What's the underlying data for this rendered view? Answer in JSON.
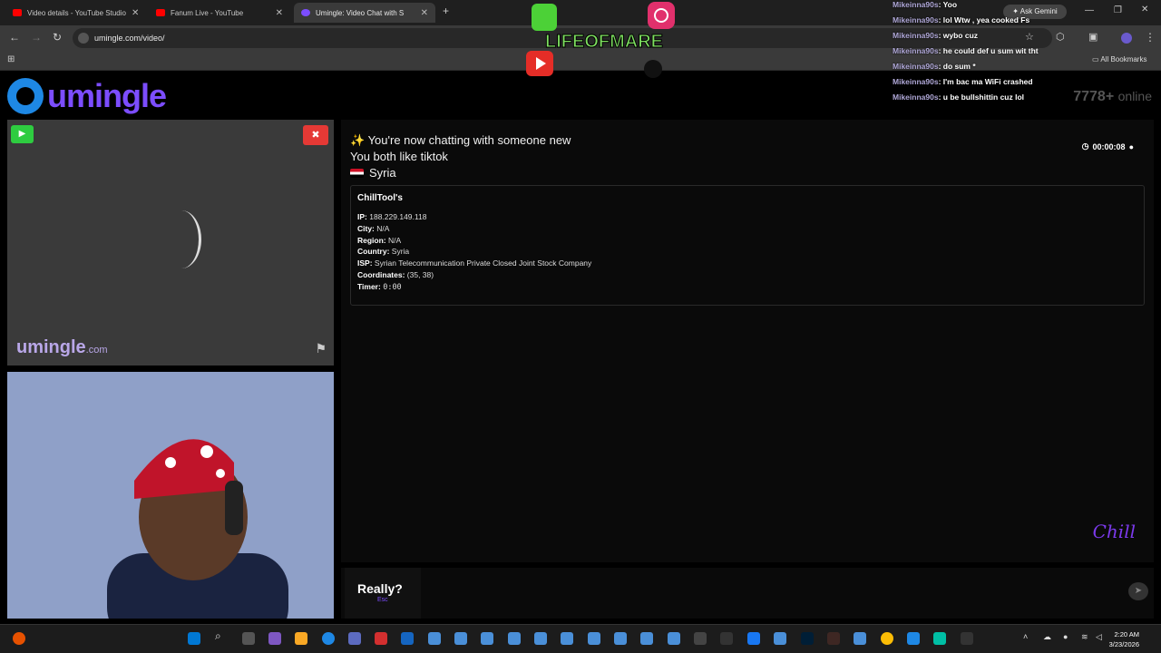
{
  "browser": {
    "tabs": [
      {
        "title": "Video details - YouTube Studio",
        "color": "#ff0000"
      },
      {
        "title": "Fanum Live - YouTube",
        "color": "#ff0000"
      },
      {
        "title": "Umingle: Video Chat with S",
        "color": "#7c4dff"
      }
    ],
    "url": "umingle.com/video/",
    "bookmarks_label": "All Bookmarks",
    "gemini_label": "Ask Gemini"
  },
  "site": {
    "logo_text": "umingle",
    "online_count": "7778+",
    "online_label": "online",
    "watermark_main": "umingle",
    "watermark_suffix": ".com"
  },
  "chat": {
    "new_msg": "You're now chatting with someone new",
    "like_msg": "You both like tiktok",
    "country": "Syria",
    "timer": "00:00:08",
    "info": {
      "title": "ChillTool's",
      "rows": [
        {
          "label": "IP:",
          "value": "188.229.149.118"
        },
        {
          "label": "City:",
          "value": "N/A"
        },
        {
          "label": "Region:",
          "value": "N/A"
        },
        {
          "label": "Country:",
          "value": "Syria"
        },
        {
          "label": "ISP:",
          "value": "Syrian Telecommunication Private Closed Joint Stock Company"
        },
        {
          "label": "Coordinates:",
          "value": "(35, 38)"
        },
        {
          "label": "Timer:",
          "value": "0:00"
        }
      ]
    }
  },
  "input": {
    "really_label": "Really?",
    "esc_label": "Esc"
  },
  "overlay": {
    "stream_title": "LIFEOFMARE",
    "chat_lines": [
      {
        "user": "Mikeinna90s",
        "text": "Yoo"
      },
      {
        "user": "Mikeinna90s",
        "text": "lol Wtw , yea cooked Fs"
      },
      {
        "user": "Mikeinna90s",
        "text": "wybo cuz"
      },
      {
        "user": "Mikeinna90s",
        "text": "he could def u sum wit tht"
      },
      {
        "user": "Mikeinna90s",
        "text": "do sum *"
      },
      {
        "user": "Mikeinna90s",
        "text": "I'm bac ma WiFi crashed"
      },
      {
        "user": "Mikeinna90s",
        "text": "u be bullshittin cuz lol"
      }
    ]
  },
  "taskbar": {
    "time": "2:20 AM",
    "date": "3/23/2026"
  }
}
